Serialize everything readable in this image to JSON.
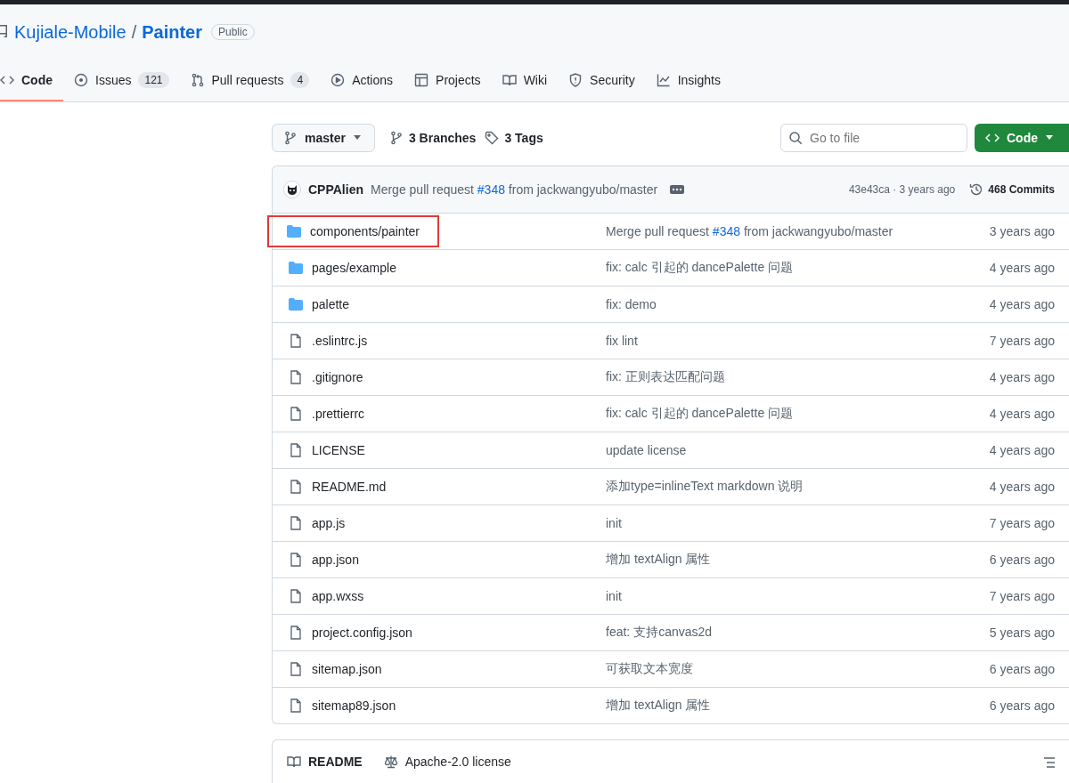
{
  "repo": {
    "owner": "Kujiale-Mobile",
    "separator": "/",
    "name": "Painter",
    "visibility": "Public"
  },
  "tabs": [
    {
      "label": "Code",
      "kind": "code",
      "selected": true
    },
    {
      "label": "Issues",
      "kind": "issue",
      "count": "121",
      "selected": false
    },
    {
      "label": "Pull requests",
      "kind": "pr",
      "count": "4",
      "selected": false
    },
    {
      "label": "Actions",
      "kind": "play",
      "selected": false
    },
    {
      "label": "Projects",
      "kind": "table",
      "selected": false
    },
    {
      "label": "Wiki",
      "kind": "book",
      "selected": false
    },
    {
      "label": "Security",
      "kind": "shield",
      "selected": false
    },
    {
      "label": "Insights",
      "kind": "graph",
      "selected": false
    }
  ],
  "toolbar": {
    "branch": "master",
    "branches": "3 Branches",
    "tags": "3 Tags",
    "search_placeholder": "Go to file",
    "code_button": "Code"
  },
  "commit": {
    "author": "CPPAlien",
    "message": [
      {
        "kind": "text",
        "text": "Merge pull request "
      },
      {
        "kind": "link",
        "text": "#348"
      },
      {
        "kind": "text",
        "text": " from jackwangyubo/master"
      }
    ],
    "hash": "43e43ca · 3 years ago",
    "commits": "468 Commits"
  },
  "files": [
    {
      "kind": "folder",
      "name": "components/painter",
      "highlighted": true,
      "message": [
        {
          "kind": "text",
          "text": "Merge pull request "
        },
        {
          "kind": "link",
          "text": "#348"
        },
        {
          "kind": "text",
          "text": " from jackwangyubo/master"
        }
      ],
      "time": "3 years ago"
    },
    {
      "kind": "folder",
      "name": "pages/example",
      "highlighted": false,
      "message": [
        {
          "kind": "text",
          "text": "fix: calc 引起的 dancePalette 问题"
        }
      ],
      "time": "4 years ago"
    },
    {
      "kind": "folder",
      "name": "palette",
      "highlighted": false,
      "message": [
        {
          "kind": "text",
          "text": "fix: demo"
        }
      ],
      "time": "4 years ago"
    },
    {
      "kind": "file",
      "name": ".eslintrc.js",
      "highlighted": false,
      "message": [
        {
          "kind": "text",
          "text": "fix lint"
        }
      ],
      "time": "7 years ago"
    },
    {
      "kind": "file",
      "name": ".gitignore",
      "highlighted": false,
      "message": [
        {
          "kind": "text",
          "text": "fix: 正则表达匹配问题"
        }
      ],
      "time": "4 years ago"
    },
    {
      "kind": "file",
      "name": ".prettierrc",
      "highlighted": false,
      "message": [
        {
          "kind": "text",
          "text": "fix: calc 引起的 dancePalette 问题"
        }
      ],
      "time": "4 years ago"
    },
    {
      "kind": "file",
      "name": "LICENSE",
      "highlighted": false,
      "message": [
        {
          "kind": "text",
          "text": "update license"
        }
      ],
      "time": "4 years ago"
    },
    {
      "kind": "file",
      "name": "README.md",
      "highlighted": false,
      "message": [
        {
          "kind": "text",
          "text": "添加type=inlineText markdown 说明"
        }
      ],
      "time": "4 years ago"
    },
    {
      "kind": "file",
      "name": "app.js",
      "highlighted": false,
      "message": [
        {
          "kind": "text",
          "text": "init"
        }
      ],
      "time": "7 years ago"
    },
    {
      "kind": "file",
      "name": "app.json",
      "highlighted": false,
      "message": [
        {
          "kind": "text",
          "text": "增加 textAlign 属性"
        }
      ],
      "time": "6 years ago"
    },
    {
      "kind": "file",
      "name": "app.wxss",
      "highlighted": false,
      "message": [
        {
          "kind": "text",
          "text": "init"
        }
      ],
      "time": "7 years ago"
    },
    {
      "kind": "file",
      "name": "project.config.json",
      "highlighted": false,
      "message": [
        {
          "kind": "text",
          "text": "feat: 支持canvas2d"
        }
      ],
      "time": "5 years ago"
    },
    {
      "kind": "file",
      "name": "sitemap.json",
      "highlighted": false,
      "message": [
        {
          "kind": "text",
          "text": "可获取文本宽度"
        }
      ],
      "time": "6 years ago"
    },
    {
      "kind": "file",
      "name": "sitemap89.json",
      "highlighted": false,
      "message": [
        {
          "kind": "text",
          "text": "增加 textAlign 属性"
        }
      ],
      "time": "6 years ago"
    }
  ],
  "readme_tabs": [
    {
      "label": "README",
      "kind": "book",
      "selected": true
    },
    {
      "label": "Apache-2.0 license",
      "kind": "scale",
      "selected": false
    }
  ]
}
